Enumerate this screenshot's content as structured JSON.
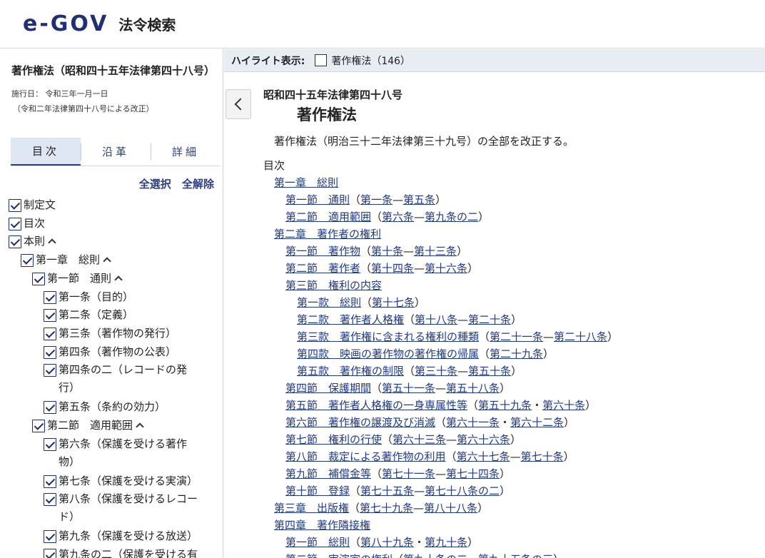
{
  "header": {
    "logo": "e-GOV",
    "title": "法令検索"
  },
  "sidebar": {
    "law_title": "著作権法（昭和四十五年法律第四十八号）",
    "effective_date": "施行日： 令和三年一月一日",
    "amendment": "（令和二年法律第四十八号による改正）",
    "tabs": [
      "目次",
      "沿革",
      "詳細"
    ],
    "select_all": "全選択",
    "deselect_all": "全解除",
    "tree": [
      {
        "label": "制定文",
        "level": 0,
        "caret": false
      },
      {
        "label": "目次",
        "level": 0,
        "caret": false
      },
      {
        "label": "本則",
        "level": 0,
        "caret": true
      },
      {
        "label": "第一章　総則",
        "level": 1,
        "caret": true
      },
      {
        "label": "第一節　通則",
        "level": 2,
        "caret": true
      },
      {
        "label": "第一条（目的）",
        "level": 3,
        "caret": false
      },
      {
        "label": "第二条（定義）",
        "level": 3,
        "caret": false
      },
      {
        "label": "第三条（著作物の発行）",
        "level": 3,
        "caret": false
      },
      {
        "label": "第四条（著作物の公表）",
        "level": 3,
        "caret": false
      },
      {
        "label": "第四条の二（レコードの発行）",
        "level": 3,
        "caret": false,
        "wrap": [
          "第四条の二（レコードの発",
          "行）"
        ]
      },
      {
        "label": "第五条（条約の効力）",
        "level": 3,
        "caret": false
      },
      {
        "label": "第二節　適用範囲",
        "level": 2,
        "caret": true
      },
      {
        "label": "第六条（保護を受ける著作物）",
        "level": 3,
        "caret": false,
        "wrap": [
          "第六条（保護を受ける著作",
          "物）"
        ]
      },
      {
        "label": "第七条（保護を受ける実演）",
        "level": 3,
        "caret": false
      },
      {
        "label": "第八条（保護を受けるレコード）",
        "level": 3,
        "caret": false,
        "wrap": [
          "第八条（保護を受けるレコー",
          "ド）"
        ]
      },
      {
        "label": "第九条（保護を受ける放送）",
        "level": 3,
        "caret": false
      },
      {
        "label": "第九条の二（保護を受ける有",
        "level": 3,
        "caret": false
      }
    ]
  },
  "main": {
    "highlight_label": "ハイライト表示:",
    "highlight_term": "著作権法（146）",
    "law_number": "昭和四十五年法律第四十八号",
    "law_name": "著作権法",
    "preamble": "著作権法（明治三十二年法律第三十九号）の全部を改正する。",
    "toc_heading": "目次",
    "toc": [
      {
        "indent": 1,
        "link": "第一章　総則",
        "range": []
      },
      {
        "indent": 2,
        "link": "第一節　通則",
        "range": [
          "第一条",
          "—",
          "第五条"
        ]
      },
      {
        "indent": 2,
        "link": "第二節　適用範囲",
        "range": [
          "第六条",
          "—",
          "第九条の二"
        ]
      },
      {
        "indent": 1,
        "link": "第二章　著作者の権利",
        "range": []
      },
      {
        "indent": 2,
        "link": "第一節　著作物",
        "range": [
          "第十条",
          "—",
          "第十三条"
        ]
      },
      {
        "indent": 2,
        "link": "第二節　著作者",
        "range": [
          "第十四条",
          "—",
          "第十六条"
        ]
      },
      {
        "indent": 2,
        "link": "第三節　権利の内容",
        "range": []
      },
      {
        "indent": 3,
        "link": "第一款　総則",
        "range": [
          "第十七条"
        ]
      },
      {
        "indent": 3,
        "link": "第二款　著作者人格権",
        "range": [
          "第十八条",
          "—",
          "第二十条"
        ]
      },
      {
        "indent": 3,
        "link": "第三款　著作権に含まれる権利の種類",
        "range": [
          "第二十一条",
          "—",
          "第二十八条"
        ]
      },
      {
        "indent": 3,
        "link": "第四款　映画の著作物の著作権の帰属",
        "range": [
          "第二十九条"
        ]
      },
      {
        "indent": 3,
        "link": "第五款　著作権の制限",
        "range": [
          "第三十条",
          "—",
          "第五十条"
        ]
      },
      {
        "indent": 2,
        "link": "第四節　保護期間",
        "range": [
          "第五十一条",
          "—",
          "第五十八条"
        ]
      },
      {
        "indent": 2,
        "link": "第五節　著作者人格権の一身専属性等",
        "range": [
          "第五十九条",
          "・",
          "第六十条"
        ]
      },
      {
        "indent": 2,
        "link": "第六節　著作権の譲渡及び消滅",
        "range": [
          "第六十一条",
          "・",
          "第六十二条"
        ]
      },
      {
        "indent": 2,
        "link": "第七節　権利の行使",
        "range": [
          "第六十三条",
          "—",
          "第六十六条"
        ]
      },
      {
        "indent": 2,
        "link": "第八節　裁定による著作物の利用",
        "range": [
          "第六十七条",
          "—",
          "第七十条"
        ]
      },
      {
        "indent": 2,
        "link": "第九節　補償金等",
        "range": [
          "第七十一条",
          "—",
          "第七十四条"
        ]
      },
      {
        "indent": 2,
        "link": "第十節　登録",
        "range": [
          "第七十五条",
          "—",
          "第七十八条の二"
        ]
      },
      {
        "indent": 1,
        "link": "第三章　出版権",
        "range": [
          "第七十九条",
          "—",
          "第八十八条"
        ]
      },
      {
        "indent": 1,
        "link": "第四章　著作隣接権",
        "range": []
      },
      {
        "indent": 2,
        "link": "第一節　総則",
        "range": [
          "第八十九条",
          "・",
          "第九十条"
        ]
      },
      {
        "indent": 2,
        "link": "第二節　実演家の権利",
        "range": [
          "第九十条の二",
          "—",
          "第九十五条の三"
        ]
      }
    ]
  }
}
